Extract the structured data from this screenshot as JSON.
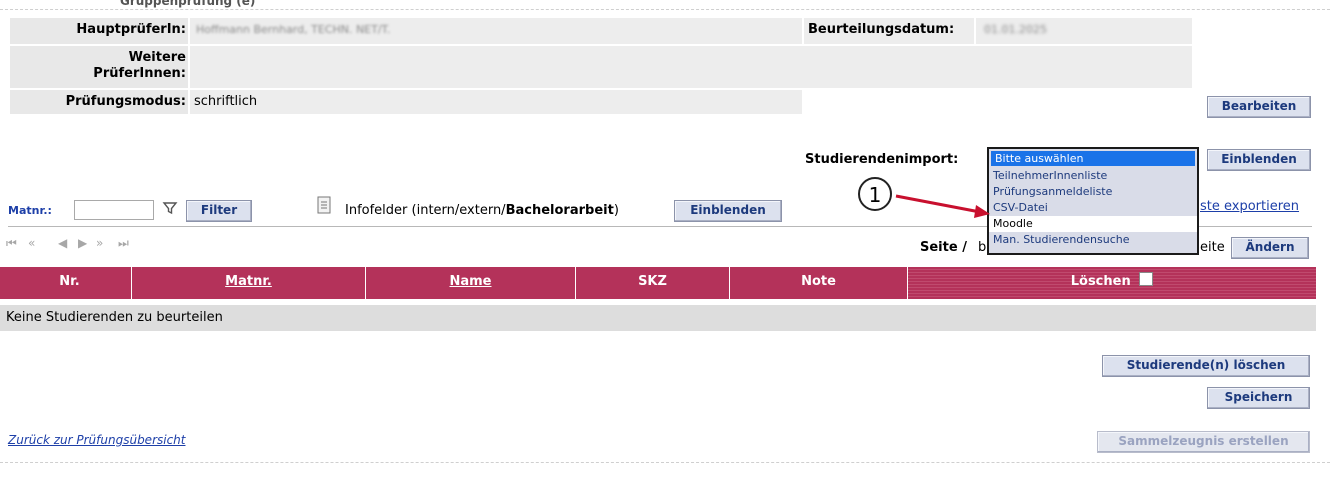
{
  "top_strip_partial": "Gruppenprüfung (e)",
  "header": {
    "examiner_label": "HauptprüferIn:",
    "examiner_value": "Hoffmann Bernhard, TECHN. NET/T.",
    "date_label": "Beurteilungsdatum:",
    "date_value": "01.01.2025",
    "other_examiners_label_1": "Weitere",
    "other_examiners_label_2": "PrüferInnen:",
    "mode_label": "Prüfungsmodus:",
    "mode_value": "schriftlich",
    "edit_button": "Bearbeiten"
  },
  "import": {
    "label": "Studierendenimport:",
    "show_button": "Einblenden",
    "options": [
      "Bitte auswählen",
      "TeilnehmerInnenliste",
      "Prüfungsanmeldeliste",
      "CSV-Datei",
      "Moodle",
      "Man. Studierendensuche"
    ],
    "selected": "Bitte auswählen",
    "export_link": "ste exportieren"
  },
  "callout": {
    "number": "1"
  },
  "filter": {
    "matnr_label": "Matnr.:",
    "matnr_value": "",
    "filter_button": "Filter",
    "infofelder_prefix": "Infofelder (intern/extern/",
    "infofelder_bold": "Bachelorarbeit",
    "infofelder_suffix": ")",
    "infofelder_button": "Einblenden"
  },
  "pager": {
    "seite_text": "Seite /",
    "b_text": "b",
    "eite_text": "eite",
    "change_button": "Ändern"
  },
  "table": {
    "columns": [
      "Nr.",
      "Matnr.",
      "Name",
      "SKZ",
      "Note",
      "Löschen"
    ],
    "empty_message": "Keine Studierenden zu beurteilen"
  },
  "actions": {
    "delete_button": "Studierende(n) löschen",
    "save_button": "Speichern",
    "back_link": "Zurück zur Prüfungsübersicht",
    "certificate_button": "Sammelzeugnis erstellen"
  },
  "colors": {
    "table_header": "#b4325a",
    "button_bg": "#dce1ee",
    "button_text": "#1d3a7d",
    "link": "#1d3fa8",
    "arrow": "#c8102e",
    "dropdown_selected": "#1a73e8"
  }
}
